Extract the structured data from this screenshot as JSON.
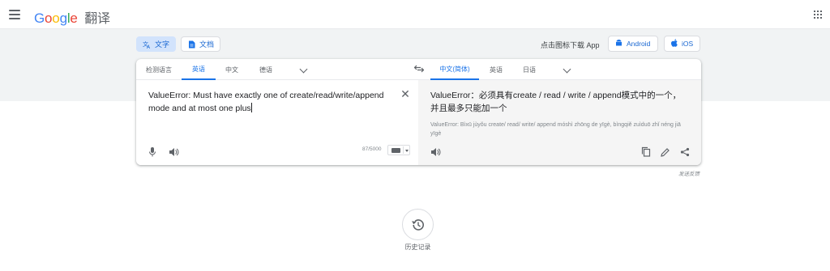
{
  "header": {
    "logo": {
      "G": "G",
      "o1": "o",
      "o2": "o",
      "g": "g",
      "l": "l",
      "e": "e"
    },
    "product_name": "翻译"
  },
  "modes": {
    "text_label": "文字",
    "doc_label": "文档"
  },
  "app_download": {
    "label": "点击图标下载 App",
    "android_label": "Android",
    "ios_label": "iOS"
  },
  "source_langs": [
    "检测语言",
    "英语",
    "中文",
    "德语"
  ],
  "source_active_index": 1,
  "target_langs": [
    "中文(简体)",
    "英语",
    "日语"
  ],
  "target_active_index": 0,
  "source": {
    "text": "ValueError: Must have exactly one of create/read/write/append mode and at most one plus",
    "char_count": "87/5000"
  },
  "target": {
    "text": "ValueError：必须具有create / read / write / append模式中的一个，并且最多只能加一个",
    "romanization": "ValueError: Bìxū jùyǒu create/ read/ write/ append móshì zhōng de yīgè, bìngqiě zuìduō zhǐ néng jiā yīgè"
  },
  "feedback_label": "发送反馈",
  "history_label": "历史记录",
  "colors": {
    "accent": "#1a73e8",
    "band": "#f1f3f4",
    "target_panel": "#f5f5f5"
  },
  "icons": [
    "menu-icon",
    "apps-icon",
    "translate-icon",
    "document-icon",
    "android-icon",
    "apple-icon",
    "swap-icon",
    "clear-icon",
    "mic-icon",
    "speaker-icon",
    "keyboard-icon",
    "copy-icon",
    "edit-icon",
    "share-icon",
    "history-icon"
  ]
}
